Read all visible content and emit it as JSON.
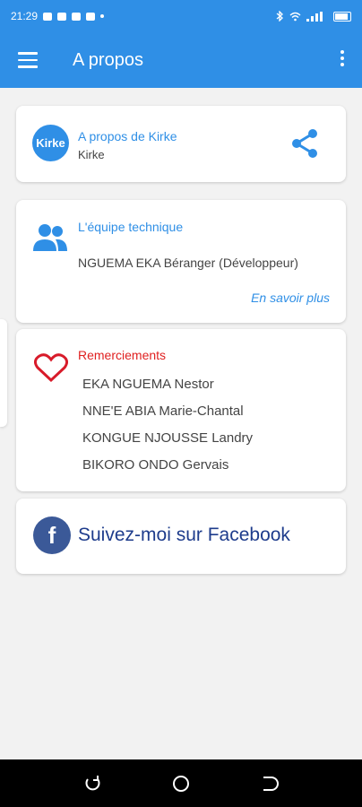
{
  "status_bar": {
    "time": "21:29",
    "notifications": [
      "message-icon",
      "facebook-icon",
      "paypal-icon",
      "messenger-icon"
    ],
    "system_icons": [
      "bluetooth-icon",
      "wifi-icon",
      "signal-icon",
      "battery-icon"
    ]
  },
  "app_bar": {
    "title": "A propos",
    "color": "#2f8fe6"
  },
  "about_card": {
    "logo_text": "Kirke",
    "title": "A propos de Kirke",
    "subtitle": "Kirke"
  },
  "team_card": {
    "title": "L'équipe technique",
    "member": "NGUEMA EKA Béranger (Développeur)",
    "more_link": "En savoir plus"
  },
  "thanks_card": {
    "title": "Remerciements",
    "names": [
      "EKA NGUEMA Nestor",
      "NNE'E ABIA Marie-Chantal",
      "KONGUE NJOUSSE Landry",
      "BIKORO ONDO Gervais"
    ]
  },
  "facebook_card": {
    "label": "Suivez-moi sur Facebook",
    "icon_letter": "f",
    "color": "#3b5998"
  }
}
